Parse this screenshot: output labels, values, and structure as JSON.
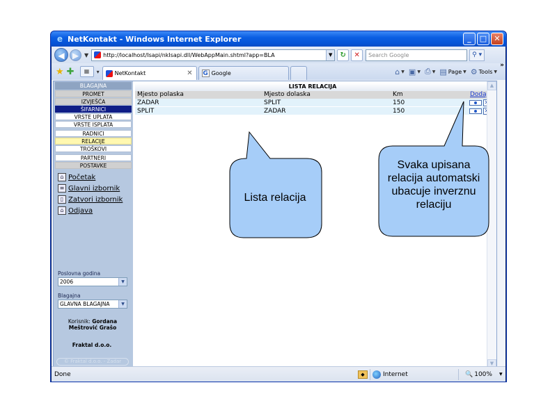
{
  "window": {
    "title": "NetKontakt - Windows Internet Explorer",
    "url": "http://localhost/Isapi/nkIsapi.dll/WebAppMain.shtml?app=BLA",
    "search_placeholder": "Search Google",
    "controls": {
      "minimize": "_",
      "maximize": "□",
      "close": "✕"
    }
  },
  "tabs": [
    {
      "label": "NetKontakt",
      "active": true
    },
    {
      "label": "Google",
      "active": false
    }
  ],
  "commandbar": {
    "page_label": "Page",
    "tools_label": "Tools"
  },
  "sidebar": {
    "header": "BLAGAJNA",
    "items": [
      {
        "label": "PROMET",
        "style": "grey"
      },
      {
        "label": "IZVJEŠĆA",
        "style": "grey"
      },
      {
        "label": "ŠIFARNICI",
        "style": "selected"
      },
      {
        "label": "VRSTE UPLATA",
        "style": "white"
      },
      {
        "label": "VRSTE ISPLATA",
        "style": "white"
      },
      {
        "label": "RADNICI",
        "style": "white"
      },
      {
        "label": "RELACIJE",
        "style": "yellow"
      },
      {
        "label": "TROŠKOVI",
        "style": "white"
      },
      {
        "label": "PARTNERI",
        "style": "white"
      },
      {
        "label": "POSTAVKE",
        "style": "grey"
      }
    ],
    "links": [
      {
        "label": "Početak",
        "icon": "home-icon"
      },
      {
        "label": "Glavni izbornik",
        "icon": "menu-icon"
      },
      {
        "label": "Zatvori izbornik",
        "icon": "close-menu-icon"
      },
      {
        "label": "Odjava",
        "icon": "lock-icon"
      }
    ],
    "year_label": "Poslovna godina",
    "year_value": "2006",
    "register_label": "Blagajna",
    "register_value": "GLAVNA BLAGAJNA",
    "user_prefix": "Korisnik:",
    "user_name": "Gordana Meštrović Grašo",
    "company": "Fraktal d.o.o.",
    "copyright": "© Fraktal d.o.o. - Zadar"
  },
  "table": {
    "title": "LISTA RELACIJA",
    "columns": [
      "Mjesto polaska",
      "Mjesto dolaska",
      "Km"
    ],
    "add_link": "Dodaj",
    "rows": [
      {
        "from": "ZADAR",
        "to": "SPLIT",
        "km": "150"
      },
      {
        "from": "SPLIT",
        "to": "ZADAR",
        "km": "150"
      }
    ]
  },
  "status": {
    "left": "Done",
    "zone": "Internet",
    "zoom": "100%"
  },
  "callouts": {
    "list": "Lista relacija",
    "inverse": "Svaka upisana relacija automatski ubacuje inverznu relaciju"
  },
  "colors": {
    "callout_fill": "#a6cdf8",
    "selected_menu": "#0f1d86",
    "row_bg": "#e2f2fb"
  }
}
